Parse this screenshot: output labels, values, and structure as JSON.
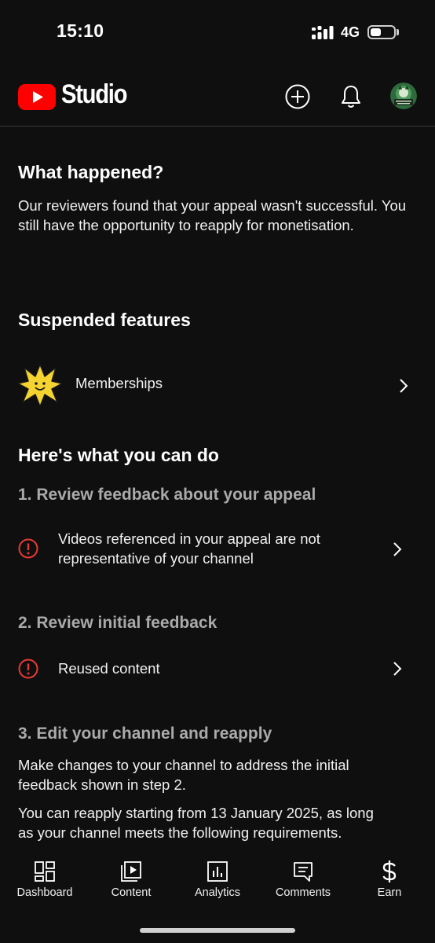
{
  "status_bar": {
    "time": "15:10",
    "network": "4G",
    "battery_level": 0.4
  },
  "app_bar": {
    "logo_text": "Studio",
    "brand_color": "#ff0000"
  },
  "what_happened": {
    "title": "What happened?",
    "body": "Our reviewers found that your appeal wasn't successful. You still have the opportunity to reapply for monetisation."
  },
  "suspended": {
    "title": "Suspended features",
    "items": [
      {
        "label": "Memberships",
        "icon": "membership-star-icon"
      }
    ]
  },
  "todo": {
    "title": "Here's what you can do",
    "step1": {
      "title": "1. Review feedback about your appeal",
      "item_lines": [
        "Videos referenced in your appeal are not",
        "representative of your channel"
      ]
    },
    "step2": {
      "title": "2. Review initial feedback",
      "item": "Reused content"
    },
    "step3": {
      "title": "3. Edit your channel and reapply",
      "para1_lines": [
        "Make changes to your channel to address the initial",
        "feedback shown in step 2."
      ],
      "para2_lines": [
        "You can reapply starting from 13 January 2025, as long",
        "as your channel meets the following requirements."
      ]
    }
  },
  "bottom_nav": [
    {
      "label": "Dashboard",
      "icon": "dashboard-icon"
    },
    {
      "label": "Content",
      "icon": "content-icon"
    },
    {
      "label": "Analytics",
      "icon": "analytics-icon"
    },
    {
      "label": "Comments",
      "icon": "comments-icon"
    },
    {
      "label": "Earn",
      "icon": "dollar-icon"
    }
  ],
  "colors": {
    "background": "#0f0f0f",
    "alert": "#e53935",
    "muted": "#aaaaaa",
    "star": "#f5d431"
  }
}
